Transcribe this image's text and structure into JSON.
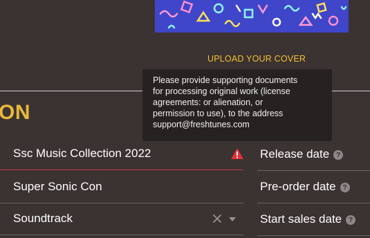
{
  "cover": {
    "upload_label": "UPLOAD YOUR COVER",
    "background_color": "#3f46c9"
  },
  "section": {
    "heading": "ON"
  },
  "tooltip": {
    "lines": [
      "Please provide supporting documents",
      "for processing original work (license",
      "agreements: or alienation, or",
      "permission to use), to the address",
      "support@freshtunes.com"
    ]
  },
  "fields": {
    "title": {
      "value": "Ssc Music Collection 2022",
      "status": "warning-icon"
    },
    "artist": {
      "value": "Super Sonic Con"
    },
    "genre": {
      "value": "Soundtrack"
    }
  },
  "dates": {
    "release_label": "Release date",
    "preorder_label": "Pre-order date",
    "start_sales_label": "Start sales date",
    "help_glyph": "?"
  },
  "colors": {
    "accent": "#e8b93a",
    "error": "#e0323a",
    "background": "#3b3232"
  }
}
